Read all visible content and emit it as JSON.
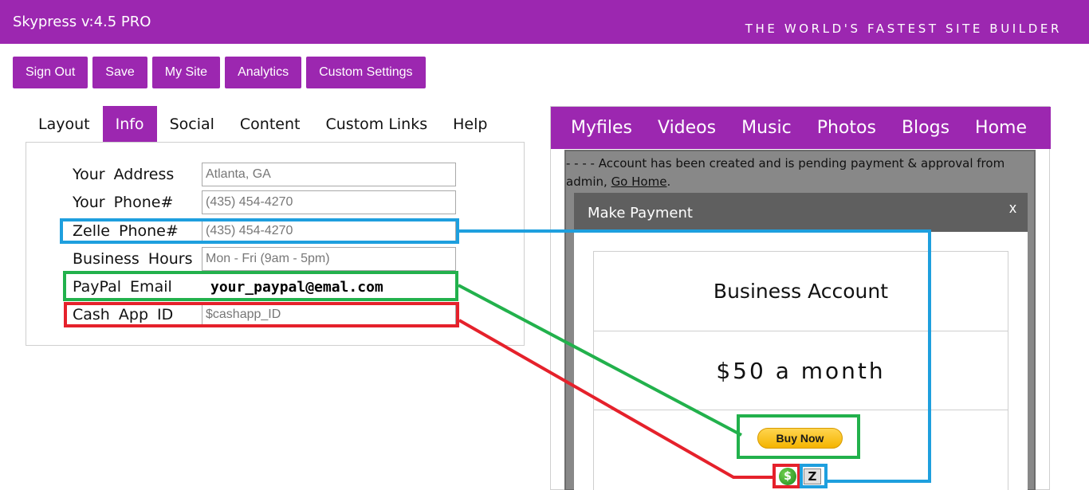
{
  "header": {
    "app_title": "Skypress v:4.5 PRO",
    "tagline": "THE WORLD'S FASTEST SITE BUILDER"
  },
  "toolbar": {
    "buttons": [
      "Sign Out",
      "Save",
      "My Site",
      "Analytics",
      "Custom Settings"
    ]
  },
  "tabs": {
    "items": [
      "Layout",
      "Info",
      "Social",
      "Content",
      "Custom Links",
      "Help"
    ],
    "active": "Info"
  },
  "form": {
    "address": {
      "label": "Your Address",
      "placeholder": "Atlanta, GA"
    },
    "phone": {
      "label": "Your Phone#",
      "placeholder": "(435) 454-4270"
    },
    "zelle": {
      "label": "Zelle Phone#",
      "placeholder": "(435) 454-4270"
    },
    "hours": {
      "label": "Business Hours",
      "placeholder": "Mon - Fri (9am - 5pm)"
    },
    "paypal": {
      "label": "PayPal Email",
      "value": "your_paypal@emal.com"
    },
    "cashapp": {
      "label": "Cash App ID",
      "placeholder": "$cashapp_ID"
    }
  },
  "preview": {
    "nav": [
      "Myfiles",
      "Videos",
      "Music",
      "Photos",
      "Blogs",
      "Home"
    ],
    "notice_text": "- - - - Account has been created and is pending payment & approval from admin,",
    "notice_link": "Go Home",
    "notice_end": ".",
    "modal": {
      "title": "Make Payment",
      "close": "x",
      "plan_name": "Business Account",
      "price": "$50 a month",
      "buy_button": "Buy Now",
      "cash_icon": "$",
      "zelle_icon": "Z"
    }
  },
  "colors": {
    "brand": "#9c27b0",
    "highlight_blue": "#1e9fde",
    "highlight_green": "#22b14c",
    "highlight_red": "#e5212b"
  },
  "icons": {
    "cash_app": "cash-app-icon",
    "zelle": "zelle-icon"
  }
}
